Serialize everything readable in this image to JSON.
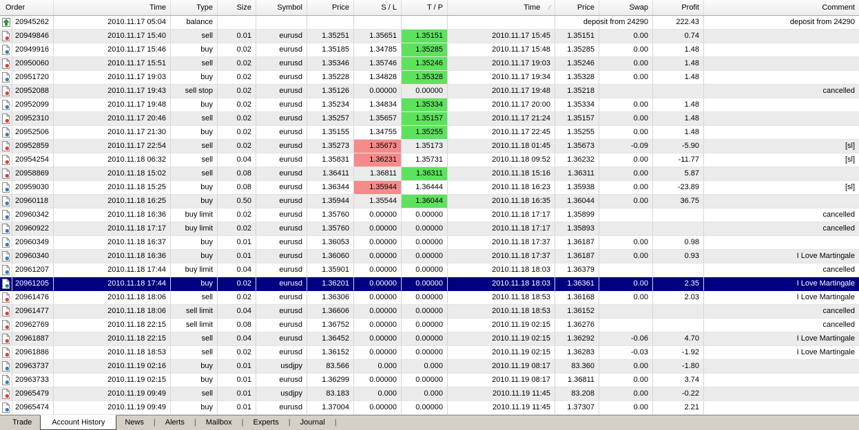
{
  "colors": {
    "selected_row_bg": "#000080",
    "tp_hit_bg": "#5EE25E",
    "sl_hit_bg": "#F58A8A",
    "buy_icon_dot": "#3A77C6",
    "sell_icon_dot": "#D8432F",
    "deposit_arrow": "#2EA02E"
  },
  "table": {
    "columns": [
      {
        "key": "order",
        "label": "Order"
      },
      {
        "key": "open_time",
        "label": "Time"
      },
      {
        "key": "type",
        "label": "Type"
      },
      {
        "key": "size",
        "label": "Size"
      },
      {
        "key": "symbol",
        "label": "Symbol"
      },
      {
        "key": "price",
        "label": "Price"
      },
      {
        "key": "sl",
        "label": "S / L"
      },
      {
        "key": "tp",
        "label": "T / P"
      },
      {
        "key": "close_time",
        "label": "Time",
        "sort_indicator": "∕"
      },
      {
        "key": "close_price",
        "label": "Price"
      },
      {
        "key": "swap",
        "label": "Swap"
      },
      {
        "key": "profit",
        "label": "Profit"
      },
      {
        "key": "comment",
        "label": "Comment"
      }
    ],
    "rows": [
      {
        "icon": "deposit",
        "order": "20945262",
        "open_time": "2010.11.17 05:04",
        "type": "balance",
        "size": "",
        "symbol": "",
        "price": "",
        "sl": "",
        "tp": "",
        "close_time": "",
        "close_price": "",
        "swap": "deposit from 24290",
        "swap_overflow": true,
        "profit": "222.43",
        "comment": "deposit from 24290"
      },
      {
        "icon": "sell",
        "order": "20949846",
        "open_time": "2010.11.17 15:40",
        "type": "sell",
        "size": "0.01",
        "symbol": "eurusd",
        "price": "1.35251",
        "sl": "1.35651",
        "tp": "1.35151",
        "tp_hl": true,
        "close_time": "2010.11.17 15:45",
        "close_price": "1.35151",
        "swap": "0.00",
        "profit": "0.74",
        "comment": ""
      },
      {
        "icon": "buy",
        "order": "20949916",
        "open_time": "2010.11.17 15:46",
        "type": "buy",
        "size": "0.02",
        "symbol": "eurusd",
        "price": "1.35185",
        "sl": "1.34785",
        "tp": "1.35285",
        "tp_hl": true,
        "close_time": "2010.11.17 15:48",
        "close_price": "1.35285",
        "swap": "0.00",
        "profit": "1.48",
        "comment": ""
      },
      {
        "icon": "sell",
        "order": "20950060",
        "open_time": "2010.11.17 15:51",
        "type": "sell",
        "size": "0.02",
        "symbol": "eurusd",
        "price": "1.35346",
        "sl": "1.35746",
        "tp": "1.35246",
        "tp_hl": true,
        "close_time": "2010.11.17 19:03",
        "close_price": "1.35246",
        "swap": "0.00",
        "profit": "1.48",
        "comment": ""
      },
      {
        "icon": "buy",
        "order": "20951720",
        "open_time": "2010.11.17 19:03",
        "type": "buy",
        "size": "0.02",
        "symbol": "eurusd",
        "price": "1.35228",
        "sl": "1.34828",
        "tp": "1.35328",
        "tp_hl": true,
        "close_time": "2010.11.17 19:34",
        "close_price": "1.35328",
        "swap": "0.00",
        "profit": "1.48",
        "comment": ""
      },
      {
        "icon": "sell",
        "order": "20952088",
        "open_time": "2010.11.17 19:43",
        "type": "sell stop",
        "size": "0.02",
        "symbol": "eurusd",
        "price": "1.35126",
        "sl": "0.00000",
        "tp": "0.00000",
        "close_time": "2010.11.17 19:48",
        "close_price": "1.35218",
        "swap": "",
        "profit": "",
        "comment": "cancelled"
      },
      {
        "icon": "buy",
        "order": "20952099",
        "open_time": "2010.11.17 19:48",
        "type": "buy",
        "size": "0.02",
        "symbol": "eurusd",
        "price": "1.35234",
        "sl": "1.34834",
        "tp": "1.35334",
        "tp_hl": true,
        "close_time": "2010.11.17 20:00",
        "close_price": "1.35334",
        "swap": "0.00",
        "profit": "1.48",
        "comment": ""
      },
      {
        "icon": "sell",
        "order": "20952310",
        "open_time": "2010.11.17 20:46",
        "type": "sell",
        "size": "0.02",
        "symbol": "eurusd",
        "price": "1.35257",
        "sl": "1.35657",
        "tp": "1.35157",
        "tp_hl": true,
        "close_time": "2010.11.17 21:24",
        "close_price": "1.35157",
        "swap": "0.00",
        "profit": "1.48",
        "comment": ""
      },
      {
        "icon": "buy",
        "order": "20952506",
        "open_time": "2010.11.17 21:30",
        "type": "buy",
        "size": "0.02",
        "symbol": "eurusd",
        "price": "1.35155",
        "sl": "1.34755",
        "tp": "1.35255",
        "tp_hl": true,
        "close_time": "2010.11.17 22:45",
        "close_price": "1.35255",
        "swap": "0.00",
        "profit": "1.48",
        "comment": ""
      },
      {
        "icon": "sell",
        "order": "20952859",
        "open_time": "2010.11.17 22:54",
        "type": "sell",
        "size": "0.02",
        "symbol": "eurusd",
        "price": "1.35273",
        "sl": "1.35673",
        "sl_hl": true,
        "tp": "1.35173",
        "close_time": "2010.11.18 01:45",
        "close_price": "1.35673",
        "swap": "-0.09",
        "profit": "-5.90",
        "comment": "[sl]"
      },
      {
        "icon": "sell",
        "order": "20954254",
        "open_time": "2010.11.18 06:32",
        "type": "sell",
        "size": "0.04",
        "symbol": "eurusd",
        "price": "1.35831",
        "sl": "1.36231",
        "sl_hl": true,
        "tp": "1.35731",
        "close_time": "2010.11.18 09:52",
        "close_price": "1.36232",
        "swap": "0.00",
        "profit": "-11.77",
        "comment": "[sl]"
      },
      {
        "icon": "sell",
        "order": "20958869",
        "open_time": "2010.11.18 15:02",
        "type": "sell",
        "size": "0.08",
        "symbol": "eurusd",
        "price": "1.36411",
        "sl": "1.36811",
        "tp": "1.36311",
        "tp_hl": true,
        "close_time": "2010.11.18 15:16",
        "close_price": "1.36311",
        "swap": "0.00",
        "profit": "5.87",
        "comment": ""
      },
      {
        "icon": "buy",
        "order": "20959030",
        "open_time": "2010.11.18 15:25",
        "type": "buy",
        "size": "0.08",
        "symbol": "eurusd",
        "price": "1.36344",
        "sl": "1.35944",
        "sl_hl": true,
        "tp": "1.36444",
        "close_time": "2010.11.18 16:23",
        "close_price": "1.35938",
        "swap": "0.00",
        "profit": "-23.89",
        "comment": "[sl]"
      },
      {
        "icon": "buy",
        "order": "20960118",
        "open_time": "2010.11.18 16:25",
        "type": "buy",
        "size": "0.50",
        "symbol": "eurusd",
        "price": "1.35944",
        "sl": "1.35544",
        "tp": "1.36044",
        "tp_hl": true,
        "close_time": "2010.11.18 16:35",
        "close_price": "1.36044",
        "swap": "0.00",
        "profit": "36.75",
        "comment": ""
      },
      {
        "icon": "buy",
        "order": "20960342",
        "open_time": "2010.11.18 16:36",
        "type": "buy limit",
        "size": "0.02",
        "symbol": "eurusd",
        "price": "1.35760",
        "sl": "0.00000",
        "tp": "0.00000",
        "close_time": "2010.11.18 17:17",
        "close_price": "1.35899",
        "swap": "",
        "profit": "",
        "comment": "cancelled"
      },
      {
        "icon": "buy",
        "order": "20960922",
        "open_time": "2010.11.18 17:17",
        "type": "buy limit",
        "size": "0.02",
        "symbol": "eurusd",
        "price": "1.35760",
        "sl": "0.00000",
        "tp": "0.00000",
        "close_time": "2010.11.18 17:17",
        "close_price": "1.35893",
        "swap": "",
        "profit": "",
        "comment": "cancelled"
      },
      {
        "icon": "buy",
        "order": "20960349",
        "open_time": "2010.11.18 16:37",
        "type": "buy",
        "size": "0.01",
        "symbol": "eurusd",
        "price": "1.36053",
        "sl": "0.00000",
        "tp": "0.00000",
        "close_time": "2010.11.18 17:37",
        "close_price": "1.36187",
        "swap": "0.00",
        "profit": "0.98",
        "comment": ""
      },
      {
        "icon": "buy",
        "order": "20960340",
        "open_time": "2010.11.18 16:36",
        "type": "buy",
        "size": "0.01",
        "symbol": "eurusd",
        "price": "1.36060",
        "sl": "0.00000",
        "tp": "0.00000",
        "close_time": "2010.11.18 17:37",
        "close_price": "1.36187",
        "swap": "0.00",
        "profit": "0.93",
        "comment": "I Love Martingale"
      },
      {
        "icon": "buy",
        "order": "20961207",
        "open_time": "2010.11.18 17:44",
        "type": "buy limit",
        "size": "0.04",
        "symbol": "eurusd",
        "price": "1.35901",
        "sl": "0.00000",
        "tp": "0.00000",
        "close_time": "2010.11.18 18:03",
        "close_price": "1.36379",
        "swap": "",
        "profit": "",
        "comment": "cancelled"
      },
      {
        "icon": "buy",
        "order": "20961205",
        "open_time": "2010.11.18 17:44",
        "type": "buy",
        "size": "0.02",
        "symbol": "eurusd",
        "price": "1.36201",
        "sl": "0.00000",
        "tp": "0.00000",
        "close_time": "2010.11.18 18:03",
        "close_price": "1.36361",
        "swap": "0.00",
        "profit": "2.35",
        "comment": "I Love Martingale",
        "selected": true
      },
      {
        "icon": "sell",
        "order": "20961476",
        "open_time": "2010.11.18 18:06",
        "type": "sell",
        "size": "0.02",
        "symbol": "eurusd",
        "price": "1.36306",
        "sl": "0.00000",
        "tp": "0.00000",
        "close_time": "2010.11.18 18:53",
        "close_price": "1.36168",
        "swap": "0.00",
        "profit": "2.03",
        "comment": "I Love Martingale"
      },
      {
        "icon": "sell",
        "order": "20961477",
        "open_time": "2010.11.18 18:06",
        "type": "sell limit",
        "size": "0.04",
        "symbol": "eurusd",
        "price": "1.36606",
        "sl": "0.00000",
        "tp": "0.00000",
        "close_time": "2010.11.18 18:53",
        "close_price": "1.36152",
        "swap": "",
        "profit": "",
        "comment": "cancelled"
      },
      {
        "icon": "sell",
        "order": "20962769",
        "open_time": "2010.11.18 22:15",
        "type": "sell limit",
        "size": "0.08",
        "symbol": "eurusd",
        "price": "1.36752",
        "sl": "0.00000",
        "tp": "0.00000",
        "close_time": "2010.11.19 02:15",
        "close_price": "1.36276",
        "swap": "",
        "profit": "",
        "comment": "cancelled"
      },
      {
        "icon": "sell",
        "order": "20961887",
        "open_time": "2010.11.18 22:15",
        "type": "sell",
        "size": "0.04",
        "symbol": "eurusd",
        "price": "1.36452",
        "sl": "0.00000",
        "tp": "0.00000",
        "close_time": "2010.11.19 02:15",
        "close_price": "1.36292",
        "swap": "-0.06",
        "profit": "4.70",
        "comment": "I Love Martingale"
      },
      {
        "icon": "sell",
        "order": "20961886",
        "open_time": "2010.11.18 18:53",
        "type": "sell",
        "size": "0.02",
        "symbol": "eurusd",
        "price": "1.36152",
        "sl": "0.00000",
        "tp": "0.00000",
        "close_time": "2010.11.19 02:15",
        "close_price": "1.36283",
        "swap": "-0.03",
        "profit": "-1.92",
        "comment": "I Love Martingale"
      },
      {
        "icon": "buy",
        "order": "20963737",
        "open_time": "2010.11.19 02:16",
        "type": "buy",
        "size": "0.01",
        "symbol": "usdjpy",
        "price": "83.566",
        "sl": "0.000",
        "tp": "0.000",
        "close_time": "2010.11.19 08:17",
        "close_price": "83.360",
        "swap": "0.00",
        "profit": "-1.80",
        "comment": ""
      },
      {
        "icon": "buy",
        "order": "20963733",
        "open_time": "2010.11.19 02:15",
        "type": "buy",
        "size": "0.01",
        "symbol": "eurusd",
        "price": "1.36299",
        "sl": "0.00000",
        "tp": "0.00000",
        "close_time": "2010.11.19 08:17",
        "close_price": "1.36811",
        "swap": "0.00",
        "profit": "3.74",
        "comment": ""
      },
      {
        "icon": "sell",
        "order": "20965479",
        "open_time": "2010.11.19 09:49",
        "type": "sell",
        "size": "0.01",
        "symbol": "usdjpy",
        "price": "83.183",
        "sl": "0.000",
        "tp": "0.000",
        "close_time": "2010.11.19 11:45",
        "close_price": "83.208",
        "swap": "0.00",
        "profit": "-0.22",
        "comment": ""
      },
      {
        "icon": "buy",
        "order": "20965474",
        "open_time": "2010.11.19 09:49",
        "type": "buy",
        "size": "0.01",
        "symbol": "eurusd",
        "price": "1.37004",
        "sl": "0.00000",
        "tp": "0.00000",
        "close_time": "2010.11.19 11:45",
        "close_price": "1.37307",
        "swap": "0.00",
        "profit": "2.21",
        "comment": ""
      }
    ]
  },
  "tabs": {
    "items": [
      "Trade",
      "Account History",
      "News",
      "Alerts",
      "Mailbox",
      "Experts",
      "Journal"
    ],
    "active": "Account History"
  }
}
